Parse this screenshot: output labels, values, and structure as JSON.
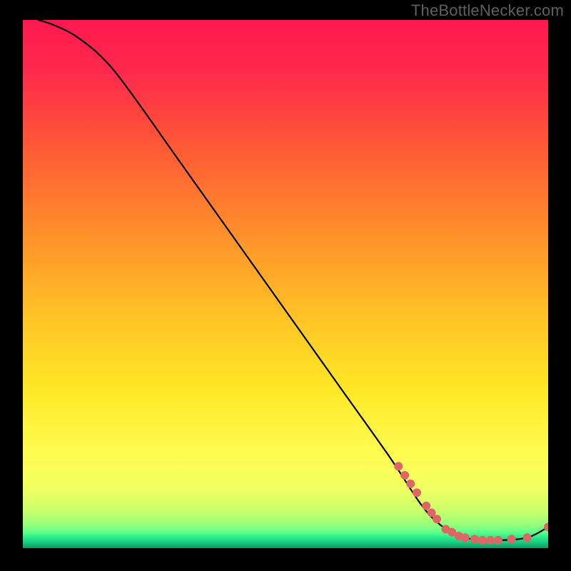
{
  "watermark": "TheBottleNecker.com",
  "chart_data": {
    "type": "line",
    "title": "",
    "xlabel": "",
    "ylabel": "",
    "xlim": [
      0,
      100
    ],
    "ylim": [
      0,
      100
    ],
    "curve": [
      {
        "x": 3,
        "y": 100
      },
      {
        "x": 6,
        "y": 99
      },
      {
        "x": 10,
        "y": 97
      },
      {
        "x": 15,
        "y": 93
      },
      {
        "x": 20,
        "y": 87
      },
      {
        "x": 30,
        "y": 73
      },
      {
        "x": 40,
        "y": 59
      },
      {
        "x": 50,
        "y": 45
      },
      {
        "x": 60,
        "y": 31
      },
      {
        "x": 70,
        "y": 17
      },
      {
        "x": 76,
        "y": 8
      },
      {
        "x": 80,
        "y": 4
      },
      {
        "x": 84,
        "y": 2
      },
      {
        "x": 90,
        "y": 1.5
      },
      {
        "x": 96,
        "y": 2
      },
      {
        "x": 100,
        "y": 4
      }
    ],
    "markers": [
      {
        "x": 71.5,
        "y": 15.5
      },
      {
        "x": 72.7,
        "y": 13.8
      },
      {
        "x": 73.8,
        "y": 12.2
      },
      {
        "x": 75.0,
        "y": 10.5
      },
      {
        "x": 76.8,
        "y": 8.0
      },
      {
        "x": 77.8,
        "y": 6.7
      },
      {
        "x": 78.8,
        "y": 5.5
      },
      {
        "x": 80.5,
        "y": 3.6
      },
      {
        "x": 81.7,
        "y": 3.0
      },
      {
        "x": 83.0,
        "y": 2.3
      },
      {
        "x": 84.2,
        "y": 2.0
      },
      {
        "x": 86.0,
        "y": 1.7
      },
      {
        "x": 87.5,
        "y": 1.5
      },
      {
        "x": 89.0,
        "y": 1.5
      },
      {
        "x": 90.5,
        "y": 1.5
      },
      {
        "x": 93.0,
        "y": 1.7
      },
      {
        "x": 96.0,
        "y": 2.0
      },
      {
        "x": 100.0,
        "y": 4.0
      }
    ],
    "marker_color": "#e06666",
    "marker_radius_px": 6,
    "curve_color": "#000000",
    "gradient_stops": [
      {
        "pct": 0,
        "color": "#ff1850"
      },
      {
        "pct": 50,
        "color": "#ffc020"
      },
      {
        "pct": 80,
        "color": "#fff84a"
      },
      {
        "pct": 97,
        "color": "#20e58b"
      },
      {
        "pct": 100,
        "color": "#0f9a62"
      }
    ]
  }
}
